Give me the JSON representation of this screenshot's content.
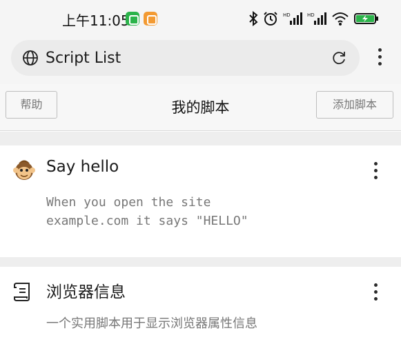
{
  "status_bar": {
    "time": "上午11:05",
    "icons": [
      "app-notification-icon",
      "app-notification-icon",
      "bluetooth-icon",
      "alarm-icon",
      "signal-icon",
      "signal-icon",
      "wifi-icon",
      "battery-charging-icon"
    ],
    "signal_labels": [
      "HD",
      "HD"
    ]
  },
  "url_bar": {
    "title": "Script List"
  },
  "header": {
    "help_label": "帮助",
    "title": "我的脚本",
    "add_label": "添加脚本"
  },
  "scripts": [
    {
      "title": "Say hello",
      "description": "When you open the site\nexample.com it says \"HELLO\"",
      "icon": "monkey-icon"
    },
    {
      "title": "浏览器信息",
      "description": "一个实用脚本用于显示浏览器属性信息",
      "icon": "script-scroll-icon"
    }
  ],
  "colors": {
    "background": "#ffffff",
    "bar_background": "#f5f5f5",
    "divider": "#eeeeee",
    "green_badge": "#2bb34a",
    "orange_badge": "#f39a32"
  }
}
